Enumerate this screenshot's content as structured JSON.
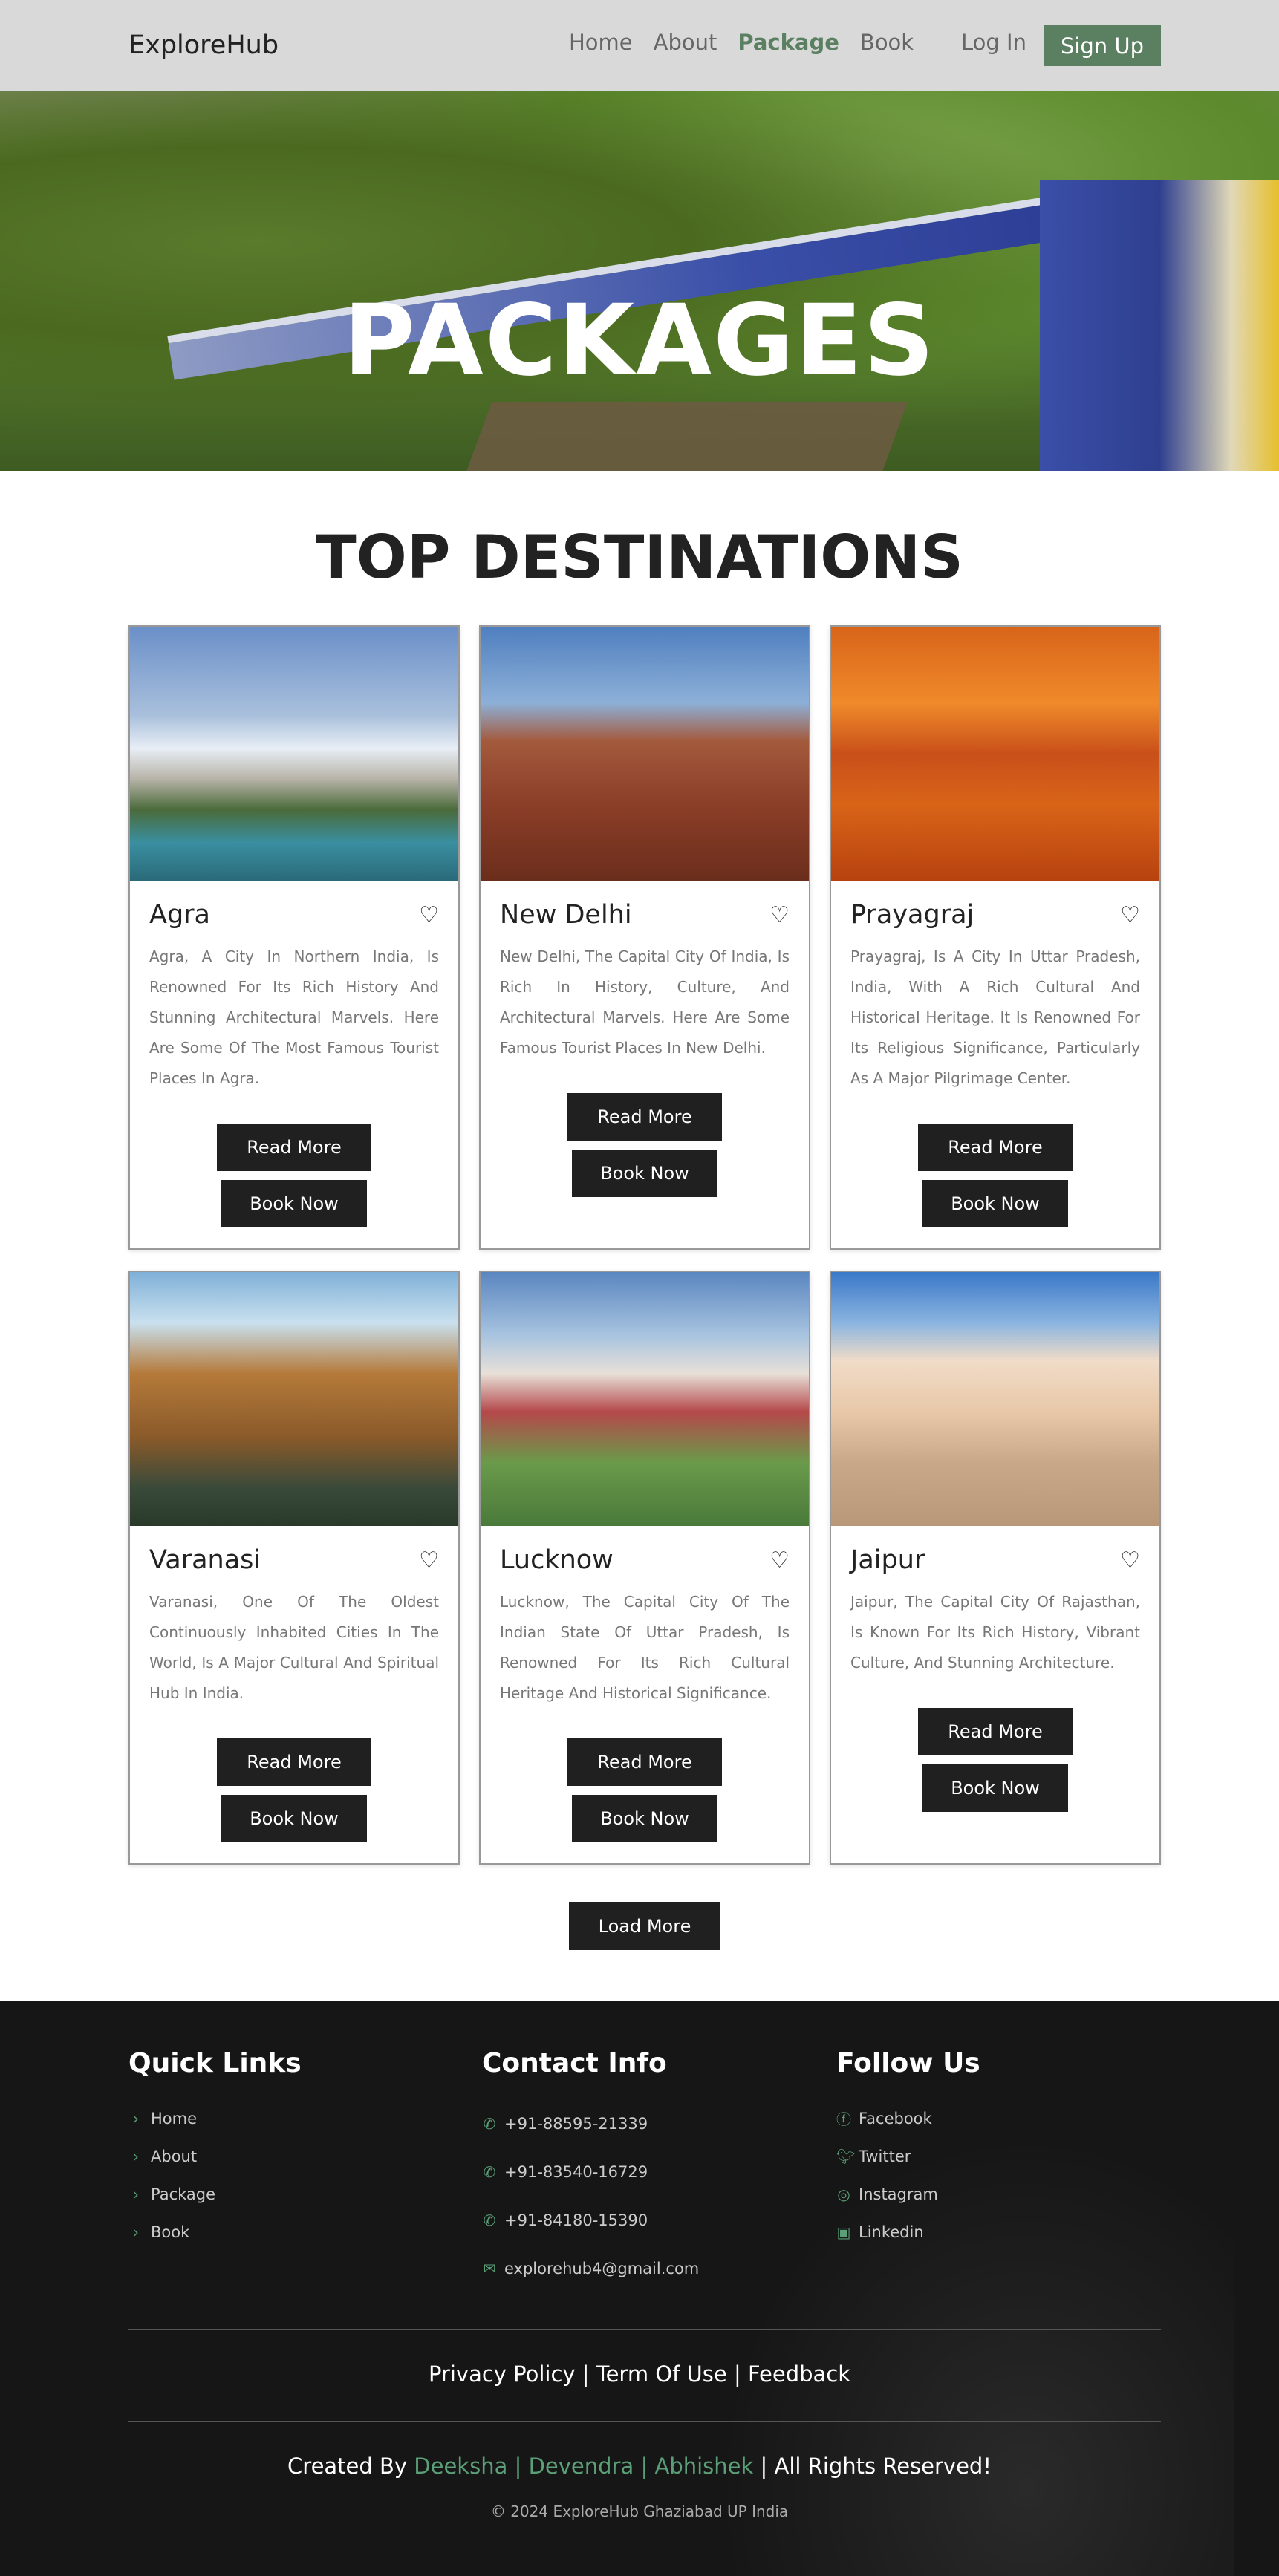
{
  "nav": {
    "brand": "ExploreHub",
    "links": [
      "Home",
      "About",
      "Package",
      "Book"
    ],
    "active": "Package",
    "login": "Log In",
    "signup": "Sign Up"
  },
  "hero": {
    "title": "PACKAGES"
  },
  "section_title": "TOP DESTINATIONS",
  "cards": [
    {
      "name": "Agra",
      "desc": "Agra, A City In Northern India, Is Renowned For Its Rich History And Stunning Architectural Marvels. Here Are Some Of The Most Famous Tourist Places In Agra.",
      "read": "Read More",
      "book": "Book Now"
    },
    {
      "name": "New Delhi",
      "desc": "New Delhi, The Capital City Of India, Is Rich In History, Culture, And Architectural Marvels. Here Are Some Famous Tourist Places In New Delhi.",
      "read": "Read More",
      "book": "Book Now"
    },
    {
      "name": "Prayagraj",
      "desc": "Prayagraj, Is A City In Uttar Pradesh, India, With A Rich Cultural And Historical Heritage. It Is Renowned For Its Religious Significance, Particularly As A Major Pilgrimage Center.",
      "read": "Read More",
      "book": "Book Now"
    },
    {
      "name": "Varanasi",
      "desc": "Varanasi, One Of The Oldest Continuously Inhabited Cities In The World, Is A Major Cultural And Spiritual Hub In India.",
      "read": "Read More",
      "book": "Book Now"
    },
    {
      "name": "Lucknow",
      "desc": "Lucknow, The Capital City Of The Indian State Of Uttar Pradesh, Is Renowned For Its Rich Cultural Heritage And Historical Significance.",
      "read": "Read More",
      "book": "Book Now"
    },
    {
      "name": "Jaipur",
      "desc": "Jaipur, The Capital City Of Rajasthan, Is Known For Its Rich History, Vibrant Culture, And Stunning Architecture.",
      "read": "Read More",
      "book": "Book Now"
    }
  ],
  "load_more": "Load More",
  "footer": {
    "quick_title": "Quick Links",
    "quick": [
      "Home",
      "About",
      "Package",
      "Book"
    ],
    "contact_title": "Contact Info",
    "phones": [
      "+91-88595-21339",
      "+91-83540-16729",
      "+91-84180-15390"
    ],
    "email": "explorehub4@gmail.com",
    "follow_title": "Follow Us",
    "social": [
      "Facebook",
      "Twitter",
      "Instagram",
      "Linkedin"
    ],
    "legal": "Privacy Policy | Term Of Use | Feedback",
    "created_by": "Created By",
    "creators": [
      "Deeksha",
      "Devendra",
      "Abhishek"
    ],
    "rights": "| All Rights Reserved!",
    "copyright": "© 2024 ExploreHub Ghaziabad UP India"
  },
  "colors": {
    "accent": "#5a7f61",
    "dark_button": "#202020",
    "footer_bg": "#161616",
    "footer_accent": "#5a9f77"
  }
}
